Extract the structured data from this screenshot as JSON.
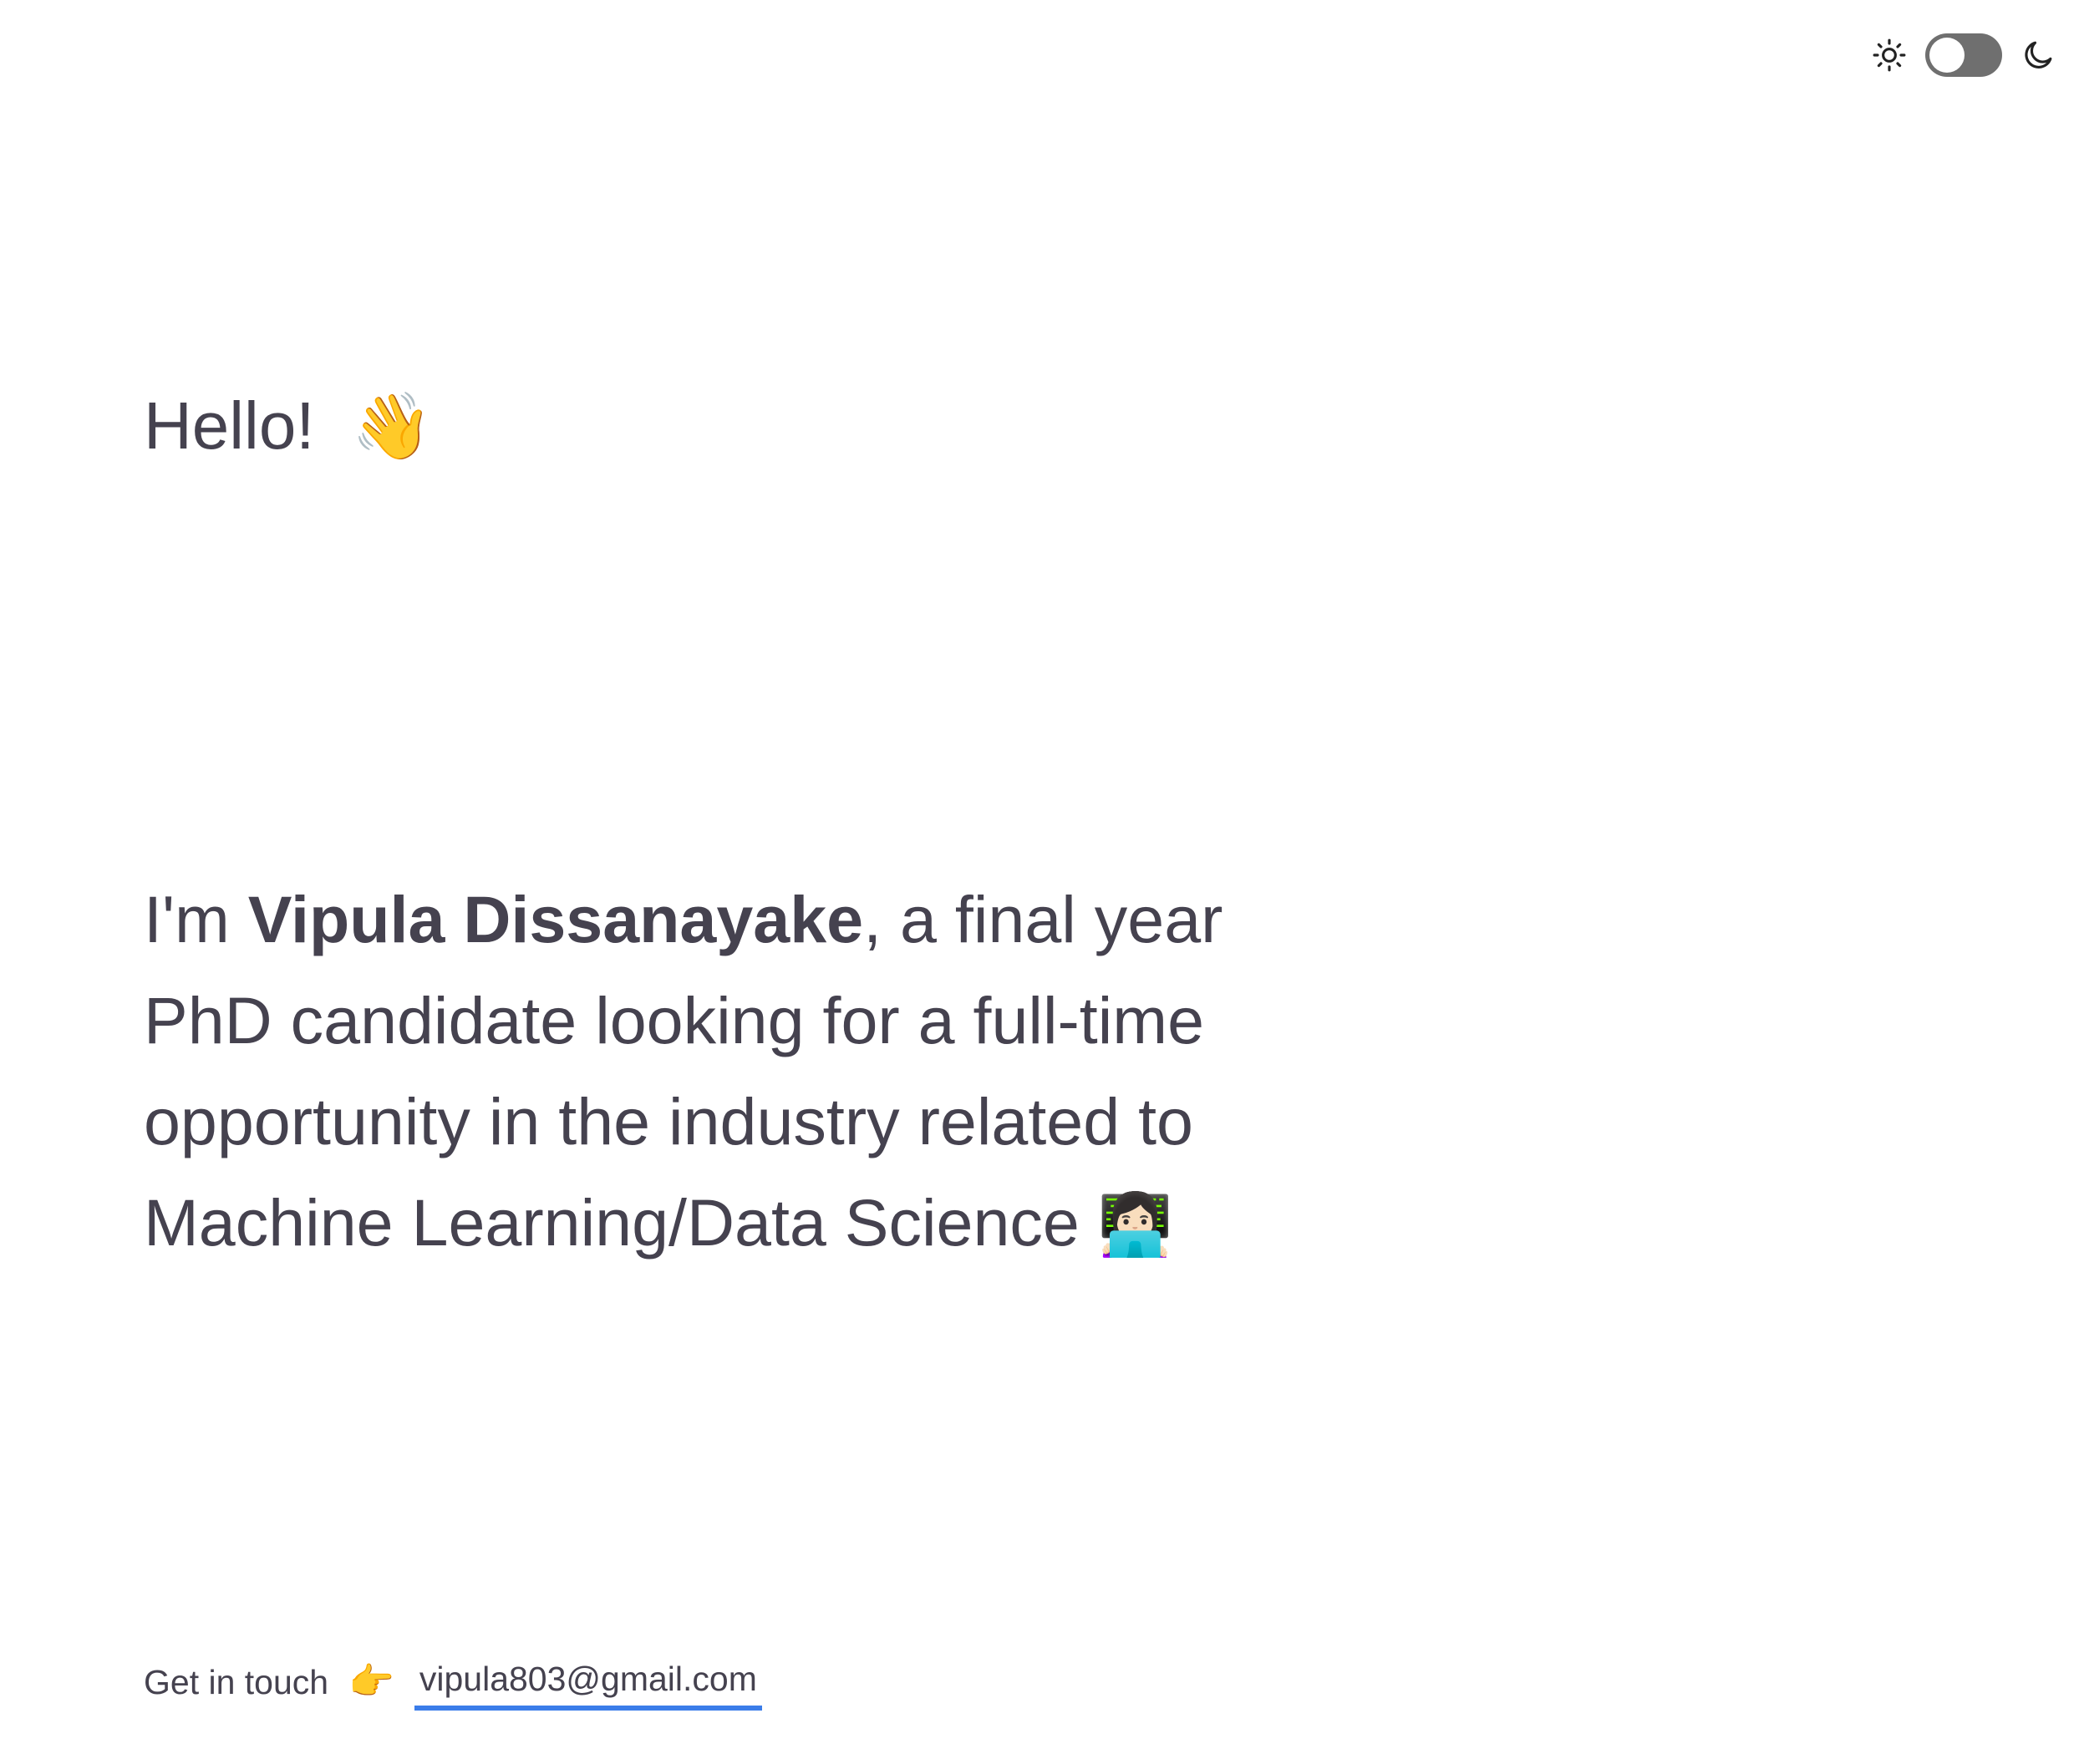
{
  "theme_toggle": {
    "light_icon": "sun-icon",
    "dark_icon": "moon-icon",
    "state": "off"
  },
  "greeting": {
    "text": "Hello!",
    "emoji": "👋"
  },
  "intro": {
    "prefix": "I'm ",
    "name": "Vipula Dissanayake",
    "suffix": ", a final year PhD candidate looking for a full-time opportunity in the industry related to Machine Learning/Data Science ",
    "emoji": "👩🏻‍💻"
  },
  "contact": {
    "label": "Get in touch",
    "emoji": "👉",
    "email": "vipula803@gmail.com",
    "link_color": "#3b7de9"
  }
}
